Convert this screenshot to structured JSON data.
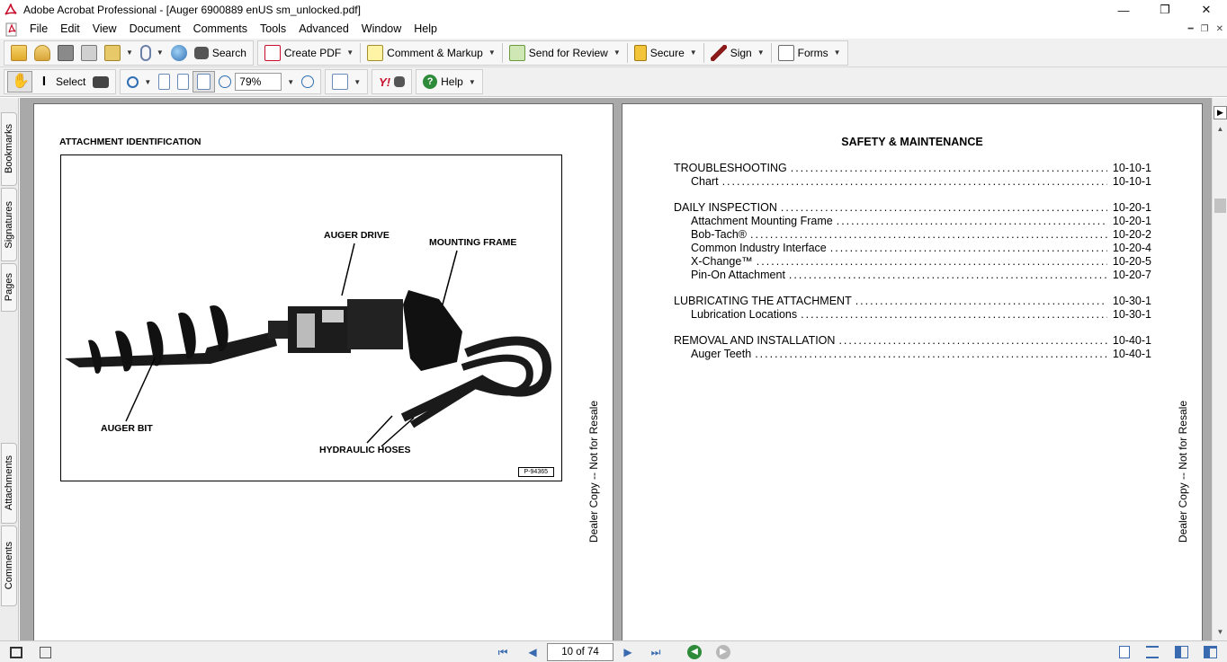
{
  "window": {
    "title": "Adobe Acrobat Professional - [Auger 6900889 enUS sm_unlocked.pdf]",
    "controls": {
      "minimize": "—",
      "maximize": "❐",
      "close": "✕"
    }
  },
  "menu": {
    "items": [
      "File",
      "Edit",
      "View",
      "Document",
      "Comments",
      "Tools",
      "Advanced",
      "Window",
      "Help"
    ]
  },
  "toolbar1": {
    "search_label": "Search",
    "create_pdf_label": "Create PDF",
    "comment_label": "Comment & Markup",
    "send_review_label": "Send for Review",
    "secure_label": "Secure",
    "sign_label": "Sign",
    "forms_label": "Forms"
  },
  "toolbar2": {
    "select_label": "Select",
    "zoom_value": "79%",
    "help_label": "Help"
  },
  "nav_tabs": [
    "Bookmarks",
    "Signatures",
    "Pages",
    "Attachments",
    "Comments"
  ],
  "left_page": {
    "heading": "ATTACHMENT IDENTIFICATION",
    "labels": {
      "auger_drive": "AUGER DRIVE",
      "mounting_frame": "MOUNTING FRAME",
      "auger_bit": "AUGER BIT",
      "hydraulic_hoses": "HYDRAULIC HOSES"
    },
    "figure_code": "P-94365",
    "watermark": "Dealer Copy -- Not for Resale"
  },
  "right_page": {
    "title": "SAFETY & MAINTENANCE",
    "toc": [
      {
        "label": "TROUBLESHOOTING",
        "page": "10-10-1",
        "level": 0
      },
      {
        "label": "Chart",
        "page": "10-10-1",
        "level": 1
      },
      {
        "label": "DAILY INSPECTION",
        "page": "10-20-1",
        "level": 0
      },
      {
        "label": "Attachment Mounting Frame",
        "page": "10-20-1",
        "level": 1
      },
      {
        "label": "Bob-Tach®",
        "page": "10-20-2",
        "level": 1
      },
      {
        "label": "Common Industry Interface",
        "page": "10-20-4",
        "level": 1
      },
      {
        "label": "X-Change™",
        "page": "10-20-5",
        "level": 1
      },
      {
        "label": "Pin-On Attachment",
        "page": "10-20-7",
        "level": 1
      },
      {
        "label": "LUBRICATING THE ATTACHMENT",
        "page": "10-30-1",
        "level": 0
      },
      {
        "label": "Lubrication Locations",
        "page": "10-30-1",
        "level": 1
      },
      {
        "label": "REMOVAL AND INSTALLATION",
        "page": "10-40-1",
        "level": 0
      },
      {
        "label": "Auger Teeth",
        "page": "10-40-1",
        "level": 1
      }
    ],
    "watermark": "Dealer Copy -- Not for Resale"
  },
  "statusbar": {
    "page_indicator": "10 of 74"
  },
  "colors": {
    "doc_background": "#a9a9a9",
    "toolbar": "#f0f0f0",
    "pdf_red": "#c8102e",
    "nav_green": "#2e8b3a"
  }
}
